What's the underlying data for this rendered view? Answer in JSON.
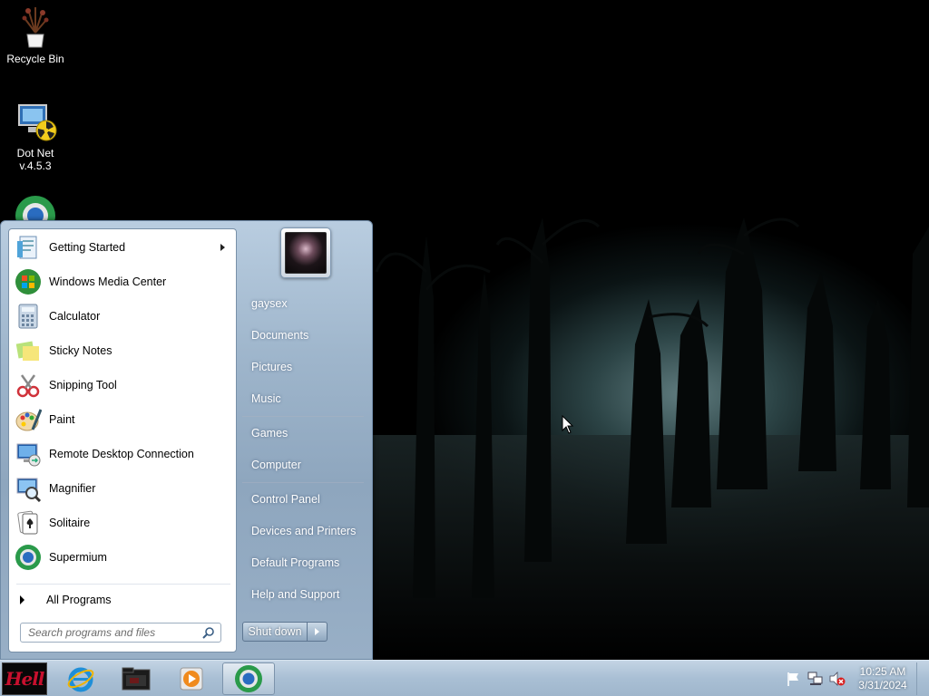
{
  "desktop": {
    "icons": [
      {
        "label": "Recycle Bin",
        "icon": "recycle-bin-icon"
      },
      {
        "label": "Dot Net\nv.4.5.3",
        "line1": "Dot Net",
        "line2": "v.4.5.3",
        "icon": "dotnet-installer-icon"
      },
      {
        "label": "",
        "icon": "supermium-icon"
      }
    ]
  },
  "start_menu": {
    "programs": [
      {
        "label": "Getting Started",
        "icon": "getting-started-icon",
        "has_submenu": true
      },
      {
        "label": "Windows Media Center",
        "icon": "windows-media-center-icon"
      },
      {
        "label": "Calculator",
        "icon": "calculator-icon"
      },
      {
        "label": "Sticky Notes",
        "icon": "sticky-notes-icon"
      },
      {
        "label": "Snipping Tool",
        "icon": "snipping-tool-icon"
      },
      {
        "label": "Paint",
        "icon": "paint-icon"
      },
      {
        "label": "Remote Desktop Connection",
        "icon": "remote-desktop-icon"
      },
      {
        "label": "Magnifier",
        "icon": "magnifier-icon"
      },
      {
        "label": "Solitaire",
        "icon": "solitaire-icon"
      },
      {
        "label": "Supermium",
        "icon": "supermium-icon"
      }
    ],
    "all_programs": "All Programs",
    "search_placeholder": "Search programs and files",
    "right_items": [
      "gaysex",
      "Documents",
      "Pictures",
      "Music",
      "Games",
      "Computer",
      "Control Panel",
      "Devices and Printers",
      "Default Programs",
      "Help and Support"
    ],
    "shutdown_label": "Shut down"
  },
  "taskbar": {
    "start_label": "Hell",
    "pinned": [
      "internet-explorer-icon",
      "folder-icon",
      "media-player-icon",
      "supermium-icon"
    ],
    "tray_icons": [
      "action-center-flag-icon",
      "network-icon",
      "volume-muted-icon"
    ],
    "clock_time": "10:25 AM",
    "clock_date": "3/31/2024"
  },
  "colors": {
    "start_menu_glass": "#9fb6cc",
    "taskbar": "#a9bfd4",
    "orb_text": "#c8102e"
  }
}
